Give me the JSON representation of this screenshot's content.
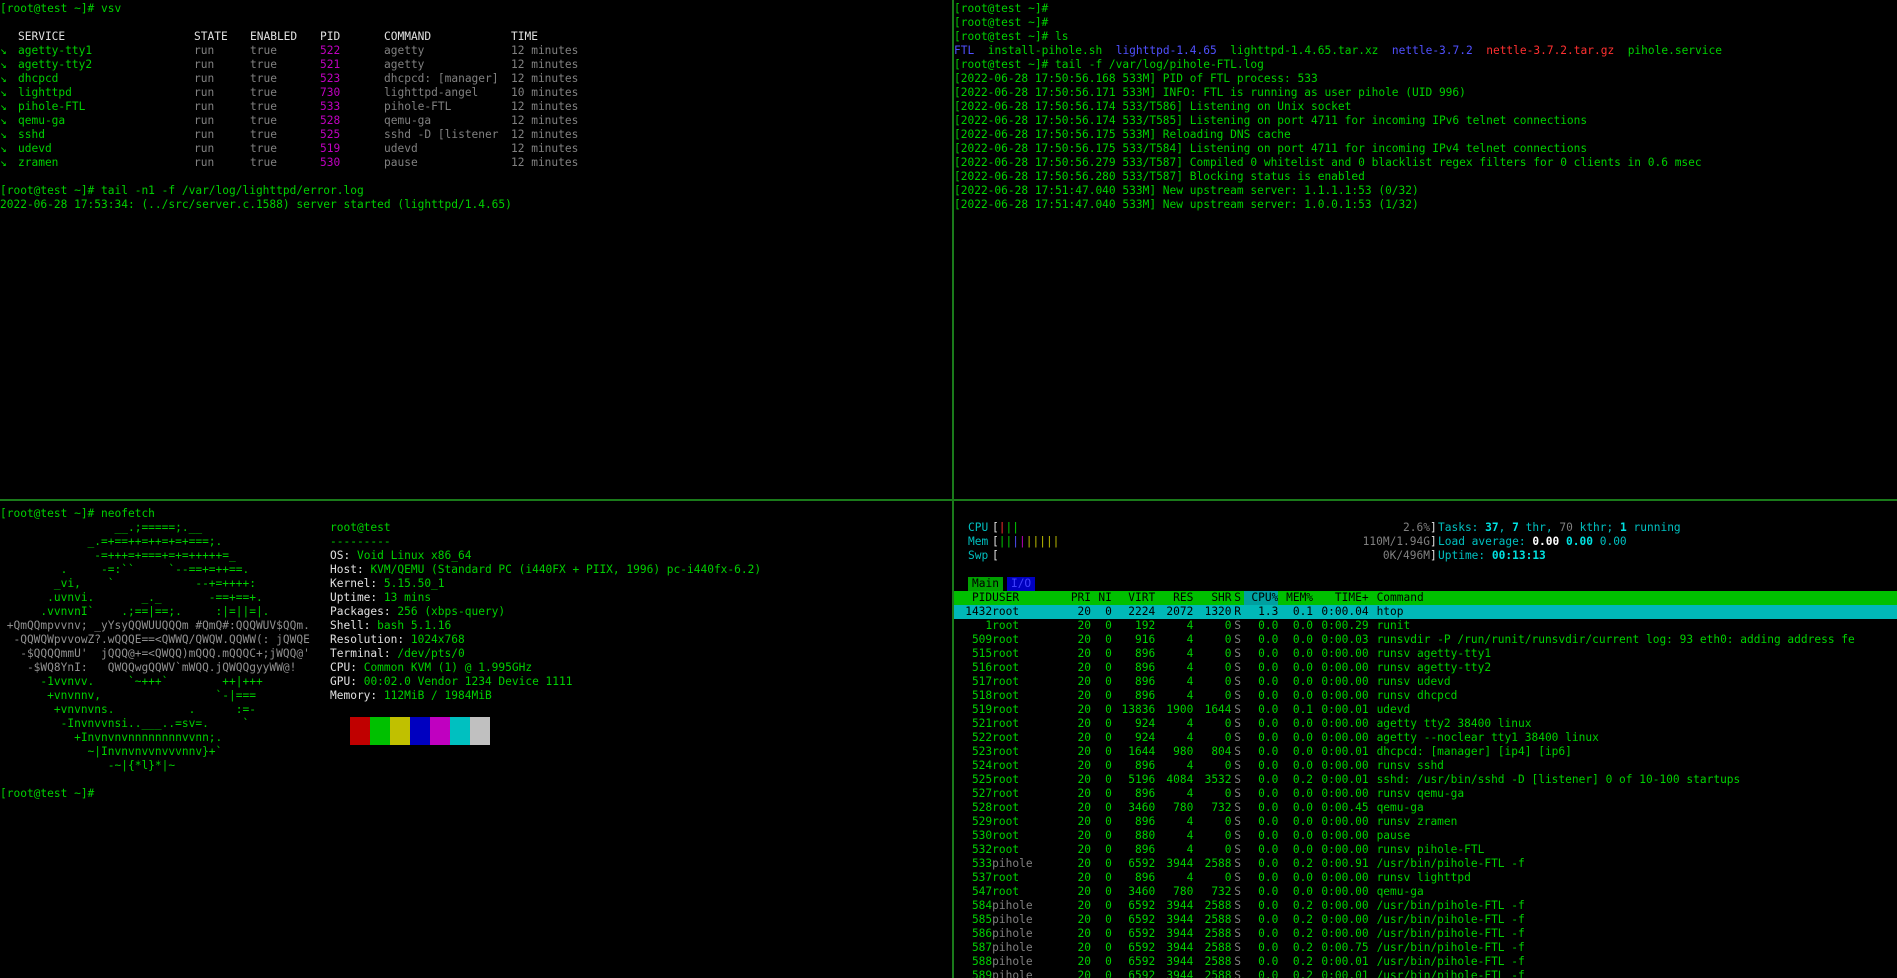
{
  "top_left": {
    "prompt1": "[root@test ~]# vsv",
    "headers": [
      "SERVICE",
      "STATE",
      "ENABLED",
      "PID",
      "COMMAND",
      "TIME"
    ],
    "services": [
      {
        "mark": "↘",
        "name": "agetty-tty1",
        "state": "run",
        "enabled": "true",
        "pid": "522",
        "cmd": "agetty",
        "time": "12 minutes"
      },
      {
        "mark": "↘",
        "name": "agetty-tty2",
        "state": "run",
        "enabled": "true",
        "pid": "521",
        "cmd": "agetty",
        "time": "12 minutes"
      },
      {
        "mark": "↘",
        "name": "dhcpcd",
        "state": "run",
        "enabled": "true",
        "pid": "523",
        "cmd": "dhcpcd: [manager]",
        "time": "12 minutes"
      },
      {
        "mark": "↘",
        "name": "lighttpd",
        "state": "run",
        "enabled": "true",
        "pid": "730",
        "cmd": "lighttpd-angel",
        "time": "10 minutes"
      },
      {
        "mark": "↘",
        "name": "pihole-FTL",
        "state": "run",
        "enabled": "true",
        "pid": "533",
        "cmd": "pihole-FTL",
        "time": "12 minutes"
      },
      {
        "mark": "↘",
        "name": "qemu-ga",
        "state": "run",
        "enabled": "true",
        "pid": "528",
        "cmd": "qemu-ga",
        "time": "12 minutes"
      },
      {
        "mark": "↘",
        "name": "sshd",
        "state": "run",
        "enabled": "true",
        "pid": "525",
        "cmd": "sshd -D [listener",
        "time": "12 minutes"
      },
      {
        "mark": "↘",
        "name": "udevd",
        "state": "run",
        "enabled": "true",
        "pid": "519",
        "cmd": "udevd",
        "time": "12 minutes"
      },
      {
        "mark": "↘",
        "name": "zramen",
        "state": "run",
        "enabled": "true",
        "pid": "530",
        "cmd": "pause",
        "time": "12 minutes"
      }
    ],
    "prompt2": "[root@test ~]# tail -n1 -f /var/log/lighttpd/error.log",
    "log": "2022-06-28 17:53:34: (../src/server.c.1588) server started (lighttpd/1.4.65)"
  },
  "top_right": {
    "prompts": [
      "[root@test ~]#",
      "[root@test ~]#",
      "[root@test ~]# ls"
    ],
    "ls": [
      {
        "name": "FTL",
        "color": "#5050ff"
      },
      {
        "name": "install-pihole.sh",
        "color": "#00d000"
      },
      {
        "name": "lighttpd-1.4.65",
        "color": "#5050ff"
      },
      {
        "name": "lighttpd-1.4.65.tar.xz",
        "color": "#00d000"
      },
      {
        "name": "nettle-3.7.2",
        "color": "#5050ff"
      },
      {
        "name": "nettle-3.7.2.tar.gz",
        "color": "#ff3030"
      },
      {
        "name": "pihole.service",
        "color": "#00d000"
      }
    ],
    "tail_cmd": "[root@test ~]# tail -f /var/log/pihole-FTL.log",
    "log": [
      "[2022-06-28 17:50:56.168 533M] PID of FTL process: 533",
      "[2022-06-28 17:50:56.171 533M] INFO: FTL is running as user pihole (UID 996)",
      "[2022-06-28 17:50:56.174 533/T586] Listening on Unix socket",
      "[2022-06-28 17:50:56.174 533/T585] Listening on port 4711 for incoming IPv6 telnet connections",
      "[2022-06-28 17:50:56.175 533M] Reloading DNS cache",
      "[2022-06-28 17:50:56.175 533/T584] Listening on port 4711 for incoming IPv4 telnet connections",
      "[2022-06-28 17:50:56.279 533/T587] Compiled 0 whitelist and 0 blacklist regex filters for 0 clients in 0.6 msec",
      "[2022-06-28 17:50:56.280 533/T587] Blocking status is enabled",
      "[2022-06-28 17:51:47.040 533M] New upstream server: 1.1.1.1:53 (0/32)",
      "[2022-06-28 17:51:47.040 533M] New upstream server: 1.0.0.1:53 (1/32)"
    ]
  },
  "bottom_left": {
    "prompt1": "[root@test ~]# neofetch",
    "logo": [
      "                 __.;=====;.__",
      "             _.=+==++=++=+=+===;.",
      "              -=+++=+===+=+=+++++=_",
      "         .     -=:``     `--==+=++==.",
      "        _vi,    `            --+=++++:",
      "       .uvnvi.       _._       -==+==+.",
      "      .vvnvnI`    .;==|==;.     :|=||=|.",
      " +QmQQmpvvnv; _yYsyQQWUUQQQm #QmQ#:QQQWUV$QQm.",
      "  -QQWQWpvvowZ?.wQQQE==<QWWQ/QWQW.QQWW(: jQWQE",
      "   -$QQQQmmU'  jQQQ@+=<QWQQ)mQQQ.mQQQC+;jWQQ@'",
      "    -$WQ8YnI:   QWQQwgQQWV`mWQQ.jQWQQgyyWW@!",
      "      -1vvnvv.     `~+++`        ++|+++",
      "       +vnvnnv,                 `-|===",
      "        +vnvnvns.           .      :=-",
      "         -Invnvvnsi..___..=sv=.     `",
      "           +Invnvnvnnnnnnnnvvnn;.",
      "             ~|Invnvnvvnvvvnnv}+`",
      "                -~|{*l}*|~"
    ],
    "info": {
      "user": "root@test",
      "sep": "---------",
      "fields": [
        {
          "k": "OS",
          "v": "Void Linux x86_64"
        },
        {
          "k": "Host",
          "v": "KVM/QEMU (Standard PC (i440FX + PIIX, 1996) pc-i440fx-6.2)"
        },
        {
          "k": "Kernel",
          "v": "5.15.50_1"
        },
        {
          "k": "Uptime",
          "v": "13 mins"
        },
        {
          "k": "Packages",
          "v": "256 (xbps-query)"
        },
        {
          "k": "Shell",
          "v": "bash 5.1.16"
        },
        {
          "k": "Resolution",
          "v": "1024x768"
        },
        {
          "k": "Terminal",
          "v": "/dev/pts/0"
        },
        {
          "k": "CPU",
          "v": "Common KVM (1) @ 1.995GHz"
        },
        {
          "k": "GPU",
          "v": "00:02.0 Vendor 1234 Device 1111"
        },
        {
          "k": "Memory",
          "v": "112MiB / 1984MiB"
        }
      ]
    },
    "palette": [
      "#000000",
      "#c00000",
      "#00c000",
      "#c0c000",
      "#0000c0",
      "#c000c0",
      "#00c0c0",
      "#c0c0c0"
    ],
    "prompt2": "[root@test ~]#"
  },
  "htop": {
    "cpu_label": "CPU",
    "cpu_pct": "2.6%",
    "mem_label": "Mem",
    "mem_val": "110M/1.94G",
    "swp_label": "Swp",
    "swp_val": "0K/496M",
    "tasks_label": "Tasks:",
    "tasks_val": "37",
    "thr_val": "7",
    "thr_label": "thr,",
    "kthr_val": "70",
    "kthr_label": "kthr;",
    "running_val": "1",
    "running_label": "running",
    "load_label": "Load average:",
    "load1": "0.00",
    "load5": "0.00",
    "load15": "0.00",
    "uptime_label": "Uptime:",
    "uptime_val": "00:13:13",
    "tab_main": "Main",
    "tab_io": "I/O",
    "headers": [
      "PID",
      "USER",
      "PRI",
      "NI",
      "VIRT",
      "RES",
      "SHR",
      "S",
      "CPU%",
      "MEM%",
      "TIME+",
      "Command"
    ],
    "rows": [
      [
        "1432",
        "root",
        "20",
        "0",
        "2224",
        "2072",
        "1320",
        "R",
        "1.3",
        "0.1",
        "0:00.04",
        "htop"
      ],
      [
        "1",
        "root",
        "20",
        "0",
        "192",
        "4",
        "0",
        "S",
        "0.0",
        "0.0",
        "0:00.29",
        "runit"
      ],
      [
        "509",
        "root",
        "20",
        "0",
        "916",
        "4",
        "0",
        "S",
        "0.0",
        "0.0",
        "0:00.03",
        "runsvdir -P /run/runit/runsvdir/current log: 93 eth0: adding address fe"
      ],
      [
        "515",
        "root",
        "20",
        "0",
        "896",
        "4",
        "0",
        "S",
        "0.0",
        "0.0",
        "0:00.00",
        "runsv agetty-tty1"
      ],
      [
        "516",
        "root",
        "20",
        "0",
        "896",
        "4",
        "0",
        "S",
        "0.0",
        "0.0",
        "0:00.00",
        "runsv agetty-tty2"
      ],
      [
        "517",
        "root",
        "20",
        "0",
        "896",
        "4",
        "0",
        "S",
        "0.0",
        "0.0",
        "0:00.00",
        "runsv udevd"
      ],
      [
        "518",
        "root",
        "20",
        "0",
        "896",
        "4",
        "0",
        "S",
        "0.0",
        "0.0",
        "0:00.00",
        "runsv dhcpcd"
      ],
      [
        "519",
        "root",
        "20",
        "0",
        "13836",
        "1900",
        "1644",
        "S",
        "0.0",
        "0.1",
        "0:00.01",
        "udevd"
      ],
      [
        "521",
        "root",
        "20",
        "0",
        "924",
        "4",
        "0",
        "S",
        "0.0",
        "0.0",
        "0:00.00",
        "agetty tty2 38400 linux"
      ],
      [
        "522",
        "root",
        "20",
        "0",
        "924",
        "4",
        "0",
        "S",
        "0.0",
        "0.0",
        "0:00.00",
        "agetty --noclear tty1 38400 linux"
      ],
      [
        "523",
        "root",
        "20",
        "0",
        "1644",
        "980",
        "804",
        "S",
        "0.0",
        "0.0",
        "0:00.01",
        "dhcpcd: [manager] [ip4] [ip6]"
      ],
      [
        "524",
        "root",
        "20",
        "0",
        "896",
        "4",
        "0",
        "S",
        "0.0",
        "0.0",
        "0:00.00",
        "runsv sshd"
      ],
      [
        "525",
        "root",
        "20",
        "0",
        "5196",
        "4084",
        "3532",
        "S",
        "0.0",
        "0.2",
        "0:00.01",
        "sshd: /usr/bin/sshd -D [listener] 0 of 10-100 startups"
      ],
      [
        "527",
        "root",
        "20",
        "0",
        "896",
        "4",
        "0",
        "S",
        "0.0",
        "0.0",
        "0:00.00",
        "runsv qemu-ga"
      ],
      [
        "528",
        "root",
        "20",
        "0",
        "3460",
        "780",
        "732",
        "S",
        "0.0",
        "0.0",
        "0:00.45",
        "qemu-ga"
      ],
      [
        "529",
        "root",
        "20",
        "0",
        "896",
        "4",
        "0",
        "S",
        "0.0",
        "0.0",
        "0:00.00",
        "runsv zramen"
      ],
      [
        "530",
        "root",
        "20",
        "0",
        "880",
        "4",
        "0",
        "S",
        "0.0",
        "0.0",
        "0:00.00",
        "pause"
      ],
      [
        "532",
        "root",
        "20",
        "0",
        "896",
        "4",
        "0",
        "S",
        "0.0",
        "0.0",
        "0:00.00",
        "runsv pihole-FTL"
      ],
      [
        "533",
        "pihole",
        "20",
        "0",
        "6592",
        "3944",
        "2588",
        "S",
        "0.0",
        "0.2",
        "0:00.91",
        "/usr/bin/pihole-FTL -f"
      ],
      [
        "537",
        "root",
        "20",
        "0",
        "896",
        "4",
        "0",
        "S",
        "0.0",
        "0.0",
        "0:00.00",
        "runsv lighttpd"
      ],
      [
        "547",
        "root",
        "20",
        "0",
        "3460",
        "780",
        "732",
        "S",
        "0.0",
        "0.0",
        "0:00.00",
        "qemu-ga"
      ],
      [
        "584",
        "pihole",
        "20",
        "0",
        "6592",
        "3944",
        "2588",
        "S",
        "0.0",
        "0.2",
        "0:00.00",
        "/usr/bin/pihole-FTL -f"
      ],
      [
        "585",
        "pihole",
        "20",
        "0",
        "6592",
        "3944",
        "2588",
        "S",
        "0.0",
        "0.2",
        "0:00.00",
        "/usr/bin/pihole-FTL -f"
      ],
      [
        "586",
        "pihole",
        "20",
        "0",
        "6592",
        "3944",
        "2588",
        "S",
        "0.0",
        "0.2",
        "0:00.00",
        "/usr/bin/pihole-FTL -f"
      ],
      [
        "587",
        "pihole",
        "20",
        "0",
        "6592",
        "3944",
        "2588",
        "S",
        "0.0",
        "0.2",
        "0:00.75",
        "/usr/bin/pihole-FTL -f"
      ],
      [
        "588",
        "pihole",
        "20",
        "0",
        "6592",
        "3944",
        "2588",
        "S",
        "0.0",
        "0.2",
        "0:00.01",
        "/usr/bin/pihole-FTL -f"
      ],
      [
        "589",
        "pihole",
        "20",
        "0",
        "6592",
        "3944",
        "2588",
        "S",
        "0.0",
        "0.2",
        "0:00.01",
        "/usr/bin/pihole-FTL -f"
      ]
    ]
  }
}
